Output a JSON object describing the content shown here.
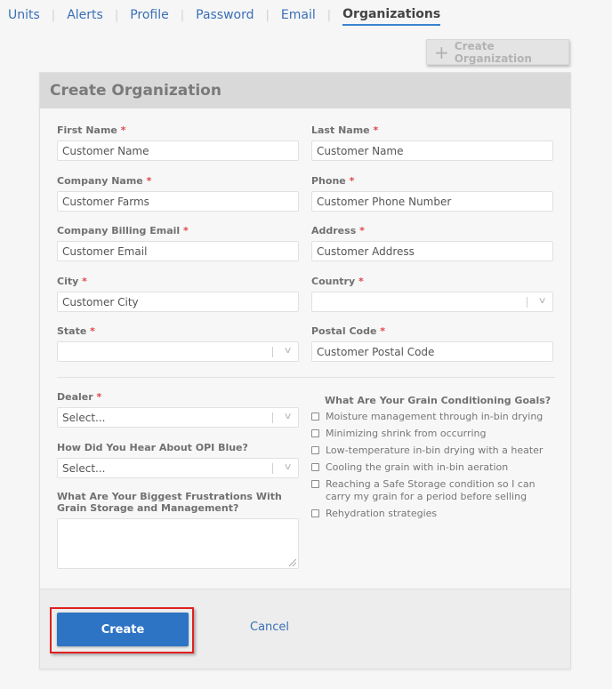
{
  "nav": {
    "tabs": [
      {
        "label": "Units",
        "active": false
      },
      {
        "label": "Alerts",
        "active": false
      },
      {
        "label": "Profile",
        "active": false
      },
      {
        "label": "Password",
        "active": false
      },
      {
        "label": "Email",
        "active": false
      },
      {
        "label": "Organizations",
        "active": true
      }
    ],
    "separator": "|"
  },
  "toolbar": {
    "create_org_label": "Create Organization",
    "create_org_icon": "plus-icon"
  },
  "form": {
    "title": "Create Organization",
    "required_mark": "*",
    "fields": {
      "first_name": {
        "label": "First Name",
        "value": "Customer Name"
      },
      "last_name": {
        "label": "Last Name",
        "value": "Customer Name"
      },
      "company_name": {
        "label": "Company Name",
        "value": "Customer Farms"
      },
      "phone": {
        "label": "Phone",
        "value": "Customer Phone Number"
      },
      "billing_email": {
        "label": "Company Billing Email",
        "value": "Customer Email"
      },
      "address": {
        "label": "Address",
        "value": "Customer Address"
      },
      "city": {
        "label": "City",
        "value": "Customer City"
      },
      "country": {
        "label": "Country",
        "value": ""
      },
      "state": {
        "label": "State",
        "value": ""
      },
      "postal_code": {
        "label": "Postal Code",
        "value": "Customer Postal Code"
      },
      "dealer": {
        "label": "Dealer",
        "value": "Select..."
      },
      "hear_about": {
        "label": "How Did You Hear About OPI Blue?",
        "value": "Select..."
      },
      "frustrations": {
        "label": "What Are Your Biggest Frustrations With Grain Storage and Management?",
        "value": ""
      }
    },
    "goals": {
      "title": "What Are Your Grain Conditioning Goals?",
      "options": [
        {
          "label": "Moisture management through in-bin drying",
          "checked": false
        },
        {
          "label": "Minimizing shrink from occurring",
          "checked": false
        },
        {
          "label": "Low-temperature in-bin drying with a heater",
          "checked": false
        },
        {
          "label": "Cooling the grain with in-bin aeration",
          "checked": false
        },
        {
          "label": "Reaching a Safe Storage condition so I can carry my grain for a period before selling",
          "checked": false
        },
        {
          "label": "Rehydration strategies",
          "checked": false
        }
      ]
    },
    "actions": {
      "create_label": "Create",
      "cancel_label": "Cancel"
    }
  },
  "colors": {
    "accent": "#2e74c4",
    "link": "#3a6fb5",
    "required": "#e04848",
    "highlight_frame": "#e02020"
  }
}
